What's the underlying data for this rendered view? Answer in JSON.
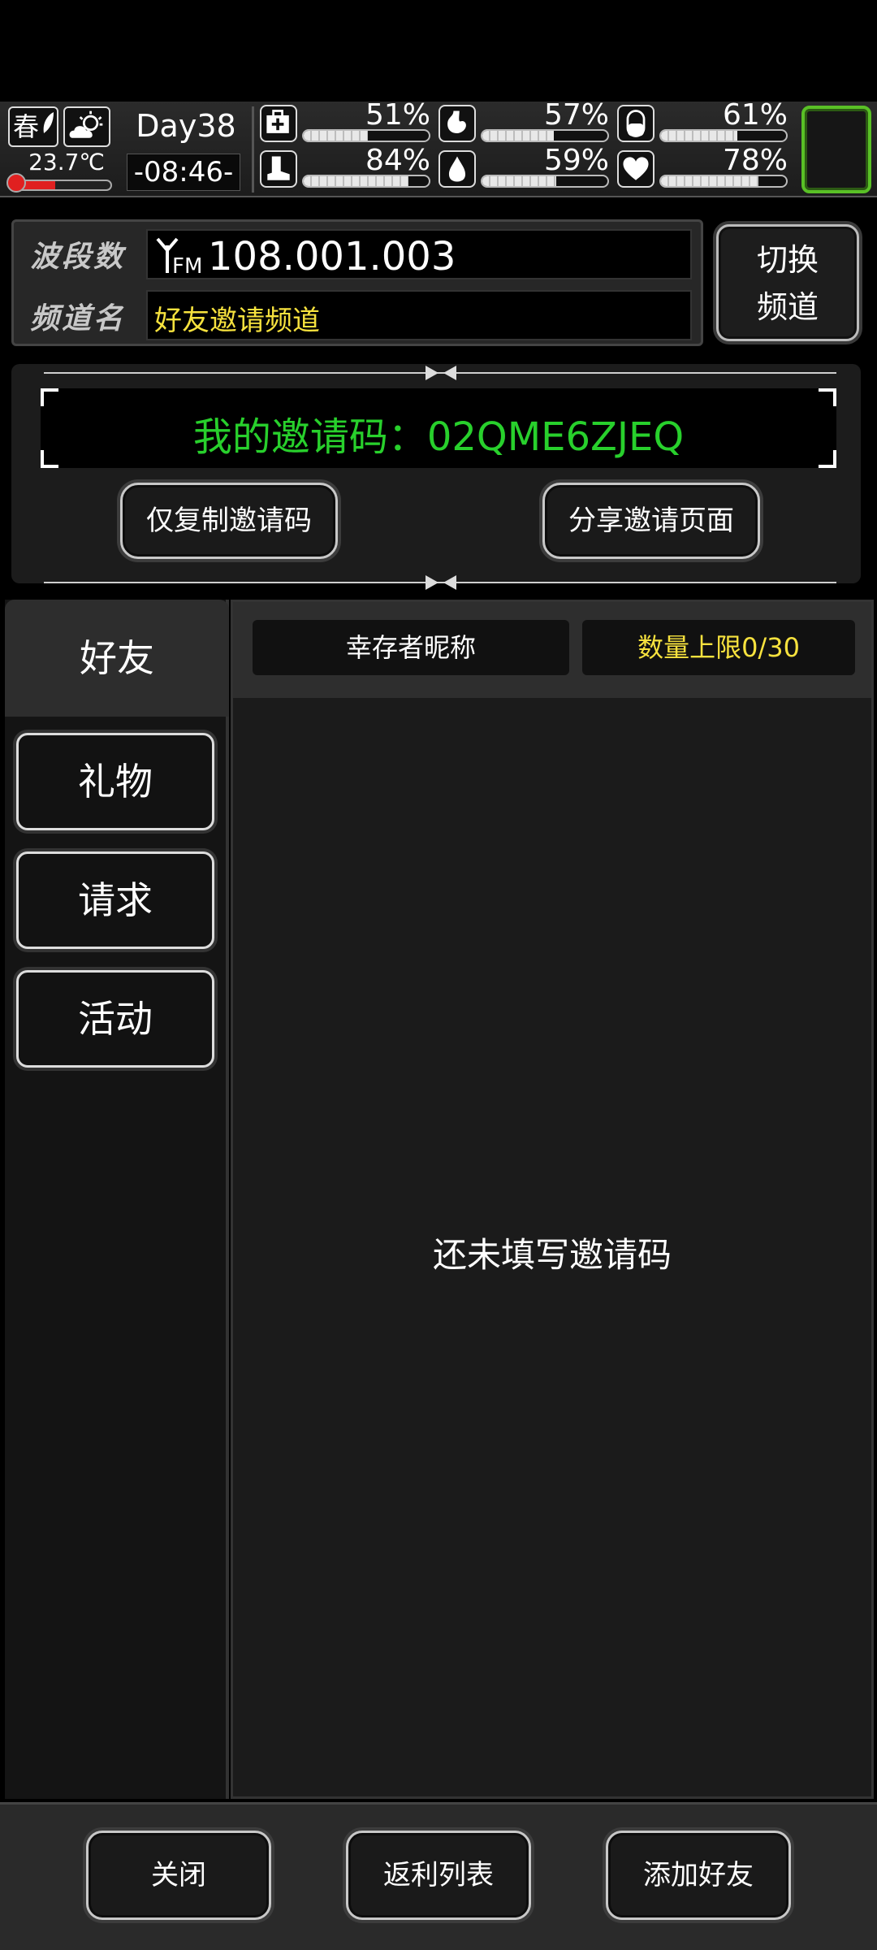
{
  "status": {
    "season": "春",
    "temperature": "23.7℃",
    "temperature_level": 0.45,
    "day": "Day38",
    "clock": "-08:46-",
    "stats": [
      {
        "icon": "medkit-icon",
        "pct": "51%",
        "level": 0.51
      },
      {
        "icon": "stomach-icon",
        "pct": "57%",
        "level": 0.57
      },
      {
        "icon": "pill-icon",
        "pct": "61%",
        "level": 0.61
      },
      {
        "icon": "boot-icon",
        "pct": "84%",
        "level": 0.84
      },
      {
        "icon": "water-drop-icon",
        "pct": "59%",
        "level": 0.59
      },
      {
        "icon": "heart-icon",
        "pct": "78%",
        "level": 0.78
      }
    ]
  },
  "radio": {
    "band_label": "波段数",
    "frequency": "108.001.003",
    "fm_label": "FM",
    "channel_label": "频道名",
    "channel_name": "好友邀请频道",
    "switch_label_1": "切换",
    "switch_label_2": "频道"
  },
  "invite": {
    "code_text": "我的邀请码：02QME6ZJEQ",
    "copy_button": "仅复制邀请码",
    "share_button": "分享邀请页面"
  },
  "tabs": {
    "friends": "好友",
    "gifts": "礼物",
    "requests": "请求",
    "events": "活动"
  },
  "list": {
    "col_name": "幸存者昵称",
    "limit": "数量上限0/30",
    "empty_message": "还未填写邀请码"
  },
  "bottom": {
    "close": "关闭",
    "rebate_list": "返利列表",
    "add_friend": "添加好友"
  },
  "colors": {
    "accent_green": "#28d02c",
    "channel_yellow": "#f7e23e",
    "slot_green": "#59c026"
  }
}
